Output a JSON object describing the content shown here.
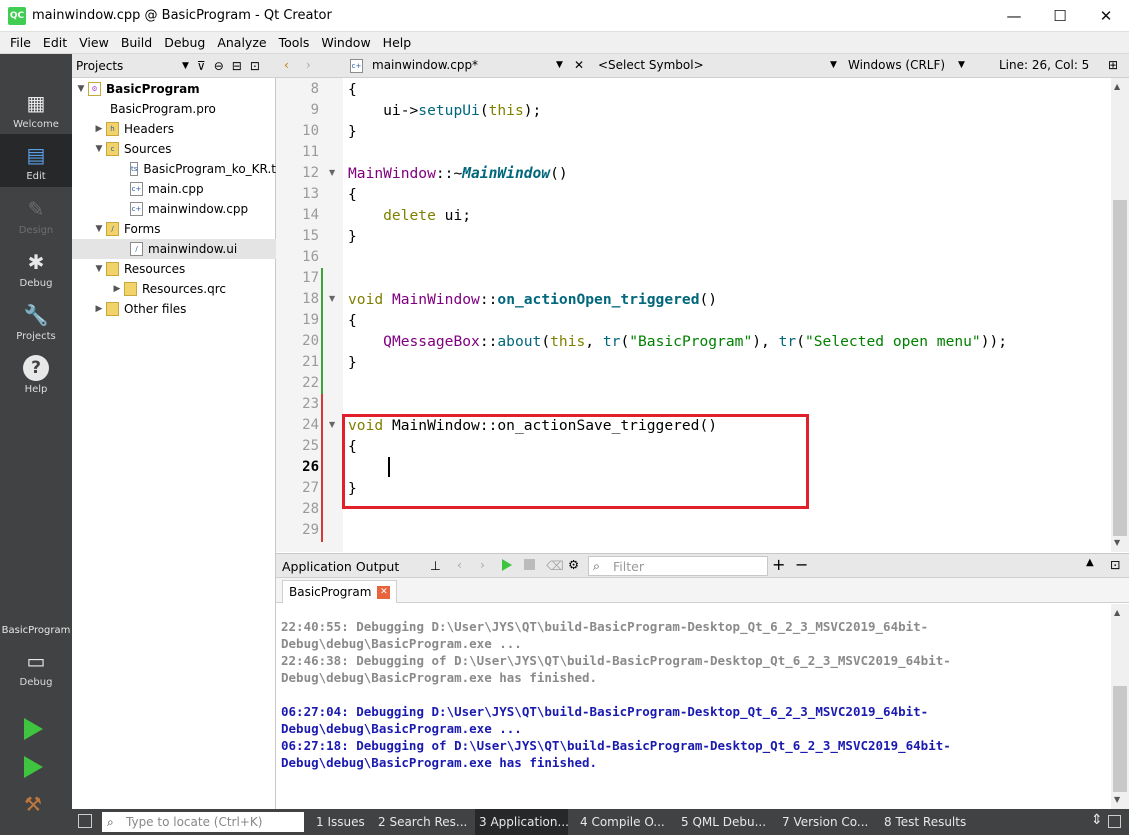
{
  "window": {
    "title": "mainwindow.cpp @ BasicProgram - Qt Creator",
    "logo": "QC",
    "minimize": "—",
    "maximize": "☐",
    "close": "✕"
  },
  "menu": [
    "File",
    "Edit",
    "View",
    "Build",
    "Debug",
    "Analyze",
    "Tools",
    "Window",
    "Help"
  ],
  "modes": [
    {
      "label": "Welcome",
      "icon": "grid-icon"
    },
    {
      "label": "Edit",
      "icon": "document-icon"
    },
    {
      "label": "Design",
      "icon": "pencil-icon"
    },
    {
      "label": "Debug",
      "icon": "bug-icon"
    },
    {
      "label": "Projects",
      "icon": "wrench-icon"
    },
    {
      "label": "Help",
      "icon": "help-icon"
    }
  ],
  "kit": {
    "project": "BasicProgram",
    "config": "Debug"
  },
  "projects_panel": {
    "title": "Projects",
    "tree": [
      {
        "label": "BasicProgram",
        "level": 0,
        "expanded": true,
        "bold": true
      },
      {
        "label": "BasicProgram.pro",
        "level": 1
      },
      {
        "label": "Headers",
        "level": 1,
        "expanded": false
      },
      {
        "label": "Sources",
        "level": 1,
        "expanded": true
      },
      {
        "label": "BasicProgram_ko_KR.ts",
        "level": 2
      },
      {
        "label": "main.cpp",
        "level": 2
      },
      {
        "label": "mainwindow.cpp",
        "level": 2
      },
      {
        "label": "Forms",
        "level": 1,
        "expanded": true
      },
      {
        "label": "mainwindow.ui",
        "level": 2,
        "selected": true
      },
      {
        "label": "Resources",
        "level": 1,
        "expanded": true
      },
      {
        "label": "Resources.qrc",
        "level": 2,
        "expanded": false
      },
      {
        "label": "Other files",
        "level": 1,
        "expanded": false
      }
    ]
  },
  "editor": {
    "file": "mainwindow.cpp*",
    "symbol": "<Select Symbol>",
    "line_ending": "Windows (CRLF)",
    "position": "Line: 26, Col: 5",
    "line_numbers": [
      "8",
      "9",
      "10",
      "11",
      "12",
      "13",
      "14",
      "15",
      "16",
      "17",
      "18",
      "19",
      "20",
      "21",
      "22",
      "23",
      "24",
      "25",
      "26",
      "27",
      "28",
      "29"
    ],
    "code": {
      "l8": "{",
      "l9_a": "    ui->",
      "l9_b": "setupUi",
      "l9_c": "(",
      "l9_d": "this",
      "l9_e": ");",
      "l10": "}",
      "l12_a": "MainWindow",
      "l12_b": "::~",
      "l12_c": "MainWindow",
      "l12_d": "()",
      "l13": "{",
      "l14_a": "    delete",
      "l14_b": " ui;",
      "l15": "}",
      "l18_a": "void",
      "l18_b": " ",
      "l18_c": "MainWindow",
      "l18_d": "::",
      "l18_e": "on_actionOpen_triggered",
      "l18_f": "()",
      "l19": "{",
      "l20_a": "    ",
      "l20_b": "QMessageBox",
      "l20_c": "::",
      "l20_d": "about",
      "l20_e": "(",
      "l20_f": "this",
      "l20_g": ", ",
      "l20_h": "tr",
      "l20_i": "(",
      "l20_j": "\"BasicProgram\"",
      "l20_k": "), ",
      "l20_l": "tr",
      "l20_m": "(",
      "l20_n": "\"Selected open menu\"",
      "l20_o": "));",
      "l21": "}",
      "l24_a": "void",
      "l24_b": " MainWindow::on_actionSave_triggered()",
      "l25": "{",
      "l27": "}"
    }
  },
  "output": {
    "title": "Application Output",
    "filter_placeholder": "Filter",
    "tab": "BasicProgram",
    "lines_old": [
      "22:40:55: Debugging D:\\User\\JYS\\QT\\build-BasicProgram-Desktop_Qt_6_2_3_MSVC2019_64bit-",
      "Debug\\debug\\BasicProgram.exe ...",
      "22:46:38: Debugging of D:\\User\\JYS\\QT\\build-BasicProgram-Desktop_Qt_6_2_3_MSVC2019_64bit-",
      "Debug\\debug\\BasicProgram.exe has finished."
    ],
    "lines_new": [
      "06:27:04: Debugging D:\\User\\JYS\\QT\\build-BasicProgram-Desktop_Qt_6_2_3_MSVC2019_64bit-",
      "Debug\\debug\\BasicProgram.exe ...",
      "06:27:18: Debugging of D:\\User\\JYS\\QT\\build-BasicProgram-Desktop_Qt_6_2_3_MSVC2019_64bit-",
      "Debug\\debug\\BasicProgram.exe has finished."
    ]
  },
  "statusbar": {
    "locator_placeholder": "Type to locate (Ctrl+K)",
    "panes": [
      "1  Issues",
      "2  Search Res...",
      "3  Application...",
      "4  Compile O...",
      "5  QML Debu...",
      "7  Version Co...",
      "8  Test Results"
    ]
  },
  "colors": {
    "highlight_box": "#e0202a",
    "sidebar": "#404244",
    "added_marker": "#3aa63a",
    "modified_marker": "#d33a3a"
  }
}
